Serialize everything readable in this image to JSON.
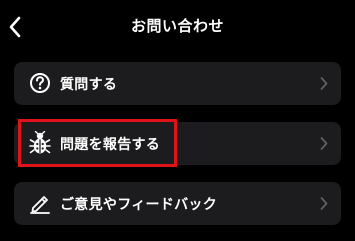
{
  "header": {
    "title": "お問い合わせ",
    "back_icon": "chevron-left-icon"
  },
  "menu": {
    "items": [
      {
        "label": "質問する",
        "icon": "question-circle-icon"
      },
      {
        "label": "問題を報告する",
        "icon": "bug-icon"
      },
      {
        "label": "ご意見やフィードバック",
        "icon": "pen-icon"
      }
    ],
    "chevron_icon": "chevron-right-icon"
  },
  "colors": {
    "background": "#000000",
    "item_background": "#1c1c1e",
    "text": "#ffffff",
    "chevron": "#5f5f63",
    "highlight": "#e1131a"
  }
}
